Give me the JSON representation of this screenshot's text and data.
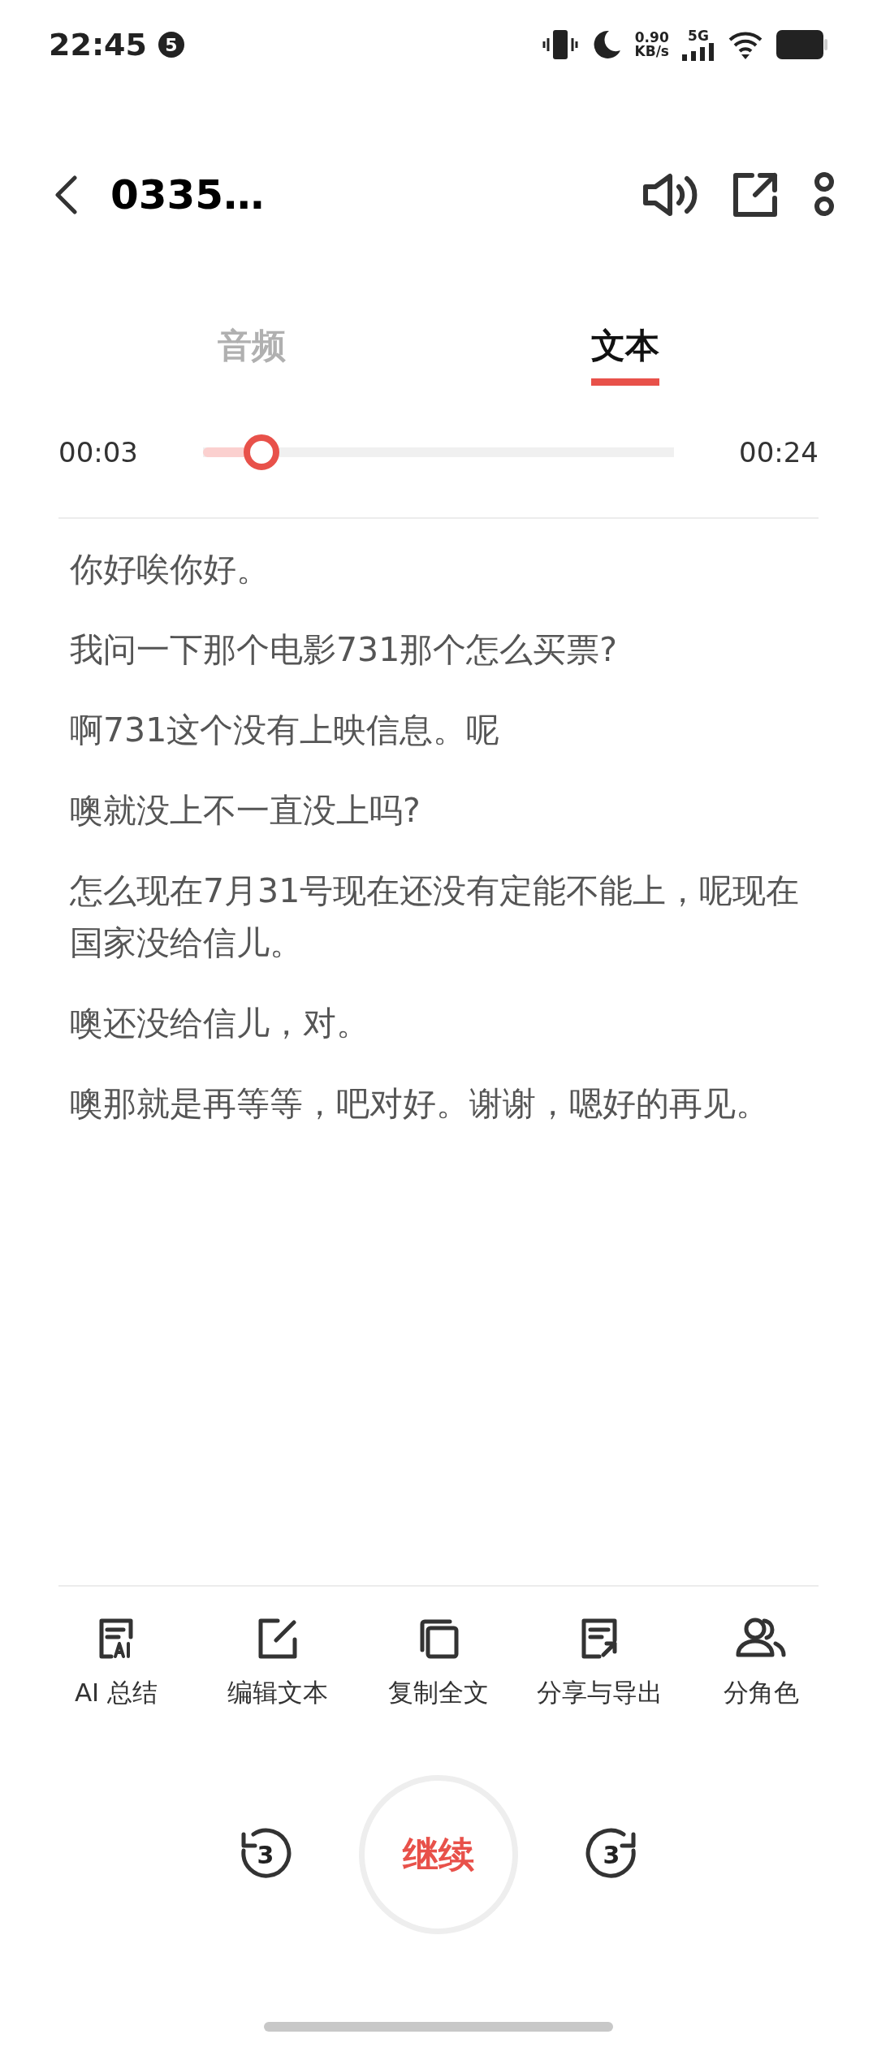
{
  "status_bar": {
    "time": "22:45",
    "notification_count": "5",
    "speed_value": "0.90",
    "speed_unit": "KB/s",
    "network": "5G"
  },
  "header": {
    "title": "0335…"
  },
  "tabs": [
    {
      "label": "音频",
      "selected": false
    },
    {
      "label": "文本",
      "selected": true
    }
  ],
  "player": {
    "elapsed": "00:03",
    "duration": "00:24",
    "level": 0.125
  },
  "transcript": [
    "你好唉你好。",
    "我问一下那个电影731那个怎么买票?",
    "啊731这个没有上映信息。呢",
    "噢就没上不一直没上吗?",
    "怎么现在7月31号现在还没有定能不能上，呢现在国家没给信儿。",
    "噢还没给信儿，对。",
    "噢那就是再等等，吧对好。谢谢，嗯好的再见。"
  ],
  "tools": [
    {
      "kind": "ai",
      "label": "AI 总结"
    },
    {
      "kind": "edit",
      "label": "编辑文本"
    },
    {
      "kind": "copy",
      "label": "复制全文"
    },
    {
      "kind": "share",
      "label": "分享与导出"
    },
    {
      "kind": "roles",
      "label": "分角色"
    }
  ],
  "controls": {
    "rewind": "3",
    "main": "继续",
    "forward": "3"
  }
}
